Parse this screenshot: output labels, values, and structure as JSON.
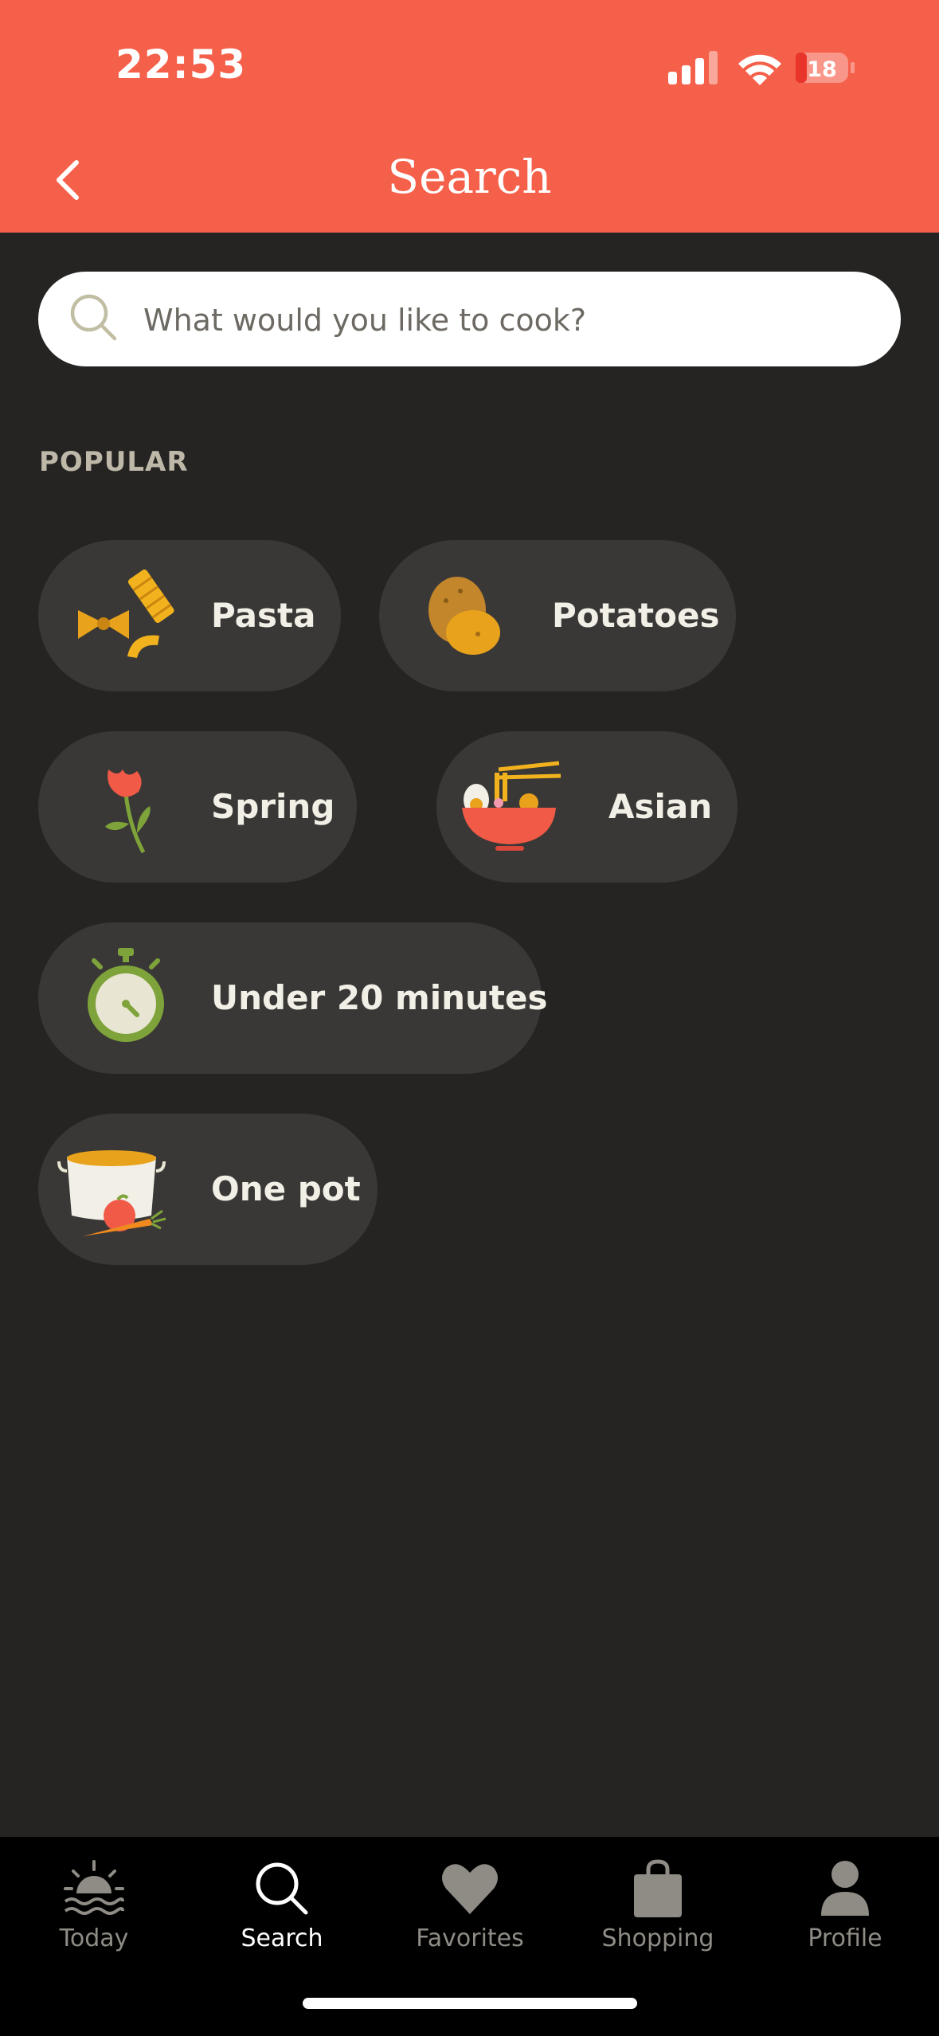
{
  "status_bar": {
    "time": "22:53",
    "battery": "18"
  },
  "header": {
    "title": "Search"
  },
  "search": {
    "placeholder": "What would you like to cook?"
  },
  "popular": {
    "label": "POPULAR",
    "chips": [
      {
        "label": "Pasta",
        "icon": "pasta-icon"
      },
      {
        "label": "Potatoes",
        "icon": "potato-icon"
      },
      {
        "label": "Spring",
        "icon": "flower-icon"
      },
      {
        "label": "Asian",
        "icon": "noodle-bowl-icon"
      },
      {
        "label": "Under 20 minutes",
        "icon": "stopwatch-icon"
      },
      {
        "label": "One pot",
        "icon": "pot-icon"
      }
    ]
  },
  "tabbar": {
    "tabs": [
      {
        "label": "Today",
        "icon": "sunrise-icon"
      },
      {
        "label": "Search",
        "icon": "search-icon",
        "active": true
      },
      {
        "label": "Favorites",
        "icon": "heart-icon"
      },
      {
        "label": "Shopping",
        "icon": "shopping-bag-icon"
      },
      {
        "label": "Profile",
        "icon": "person-icon"
      }
    ]
  },
  "colors": {
    "accent": "#F5604A",
    "background": "#252423",
    "chip": "#3a3836"
  }
}
